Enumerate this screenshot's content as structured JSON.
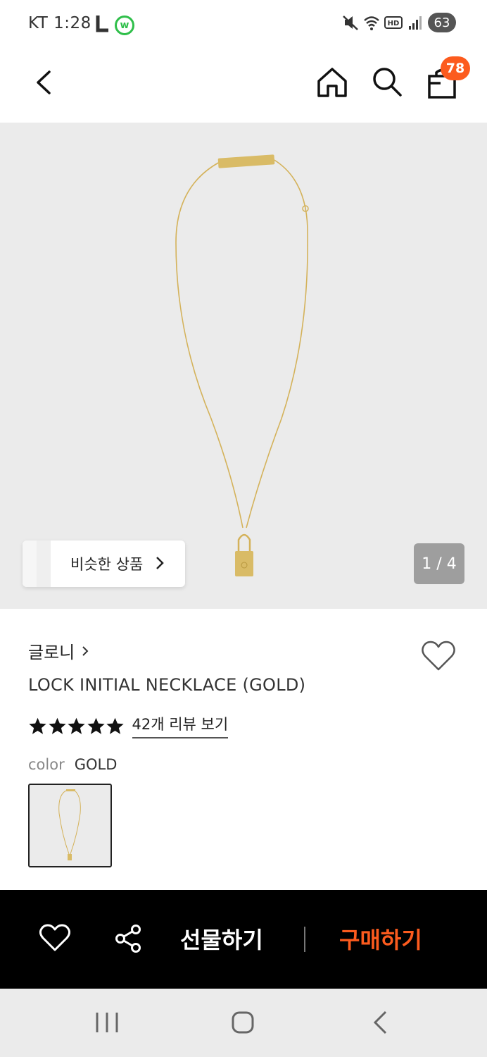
{
  "status_bar": {
    "time": "KT 1:28",
    "battery": "63",
    "app_letter": "w"
  },
  "header": {
    "cart_count": "78"
  },
  "gallery": {
    "similar_label": "비슷한 상품",
    "page_counter": "1 / 4"
  },
  "product": {
    "brand": "글로니",
    "name": "LOCK INITIAL NECKLACE (GOLD)",
    "rating_stars": 5,
    "review_link": "42개 리뷰 보기",
    "color_label": "color",
    "color_value": "GOLD"
  },
  "action_bar": {
    "gift_label": "선물하기",
    "buy_label": "구매하기"
  },
  "colors": {
    "accent": "#fc5b1e",
    "image_bg": "#ebebeb",
    "gold": "#d4b25a"
  }
}
